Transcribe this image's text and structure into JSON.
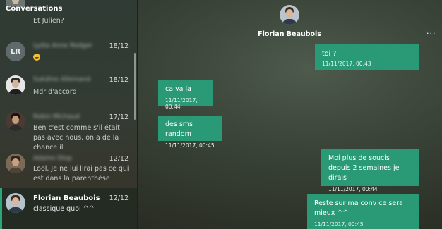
{
  "sidebar": {
    "title": "Conversations",
    "conversations": [
      {
        "name": "",
        "preview": "Et Julien?",
        "date": ""
      },
      {
        "name": "Lydia Anne Rodger",
        "initials": "LR",
        "preview": "",
        "date": "18/12"
      },
      {
        "name": "Sukdine Allemand",
        "preview": "Mdr d'accord",
        "date": "18/12"
      },
      {
        "name": "Robin Michaud",
        "preview": "Ben c'est comme s'il était pas avec nous, on a de la chance il",
        "date": "17/12"
      },
      {
        "name": "Adamo Diop",
        "preview": "Lool. Je ne lui lirai pas ce qui est dans la parenthèse",
        "date": "12/12"
      },
      {
        "name": "Florian Beaubois",
        "preview": "classique quoi ^^",
        "date": "12/12"
      }
    ]
  },
  "header": {
    "contact_name": "Florian Beaubois",
    "more_icon": "···"
  },
  "messages": [
    {
      "direction": "out",
      "text": "toi ?",
      "time": "11/11/2017, 00:43"
    },
    {
      "direction": "in",
      "text": "ca va la",
      "time": "11/11/2017, 00:44"
    },
    {
      "direction": "in",
      "text": "des sms random",
      "time": "11/11/2017, 00:45"
    },
    {
      "direction": "out",
      "text": "Moi plus de soucis depuis 2 semaines je dirais",
      "time": "11/11/2017, 00:44"
    },
    {
      "direction": "out",
      "text": "Reste sur ma conv ce sera mieux ^^",
      "time": "11/11/2017, 00:45"
    }
  ],
  "colors": {
    "bubble": "#2a9a76",
    "accent": "#2aa77a",
    "active_conversation_bg": "#232b23"
  }
}
